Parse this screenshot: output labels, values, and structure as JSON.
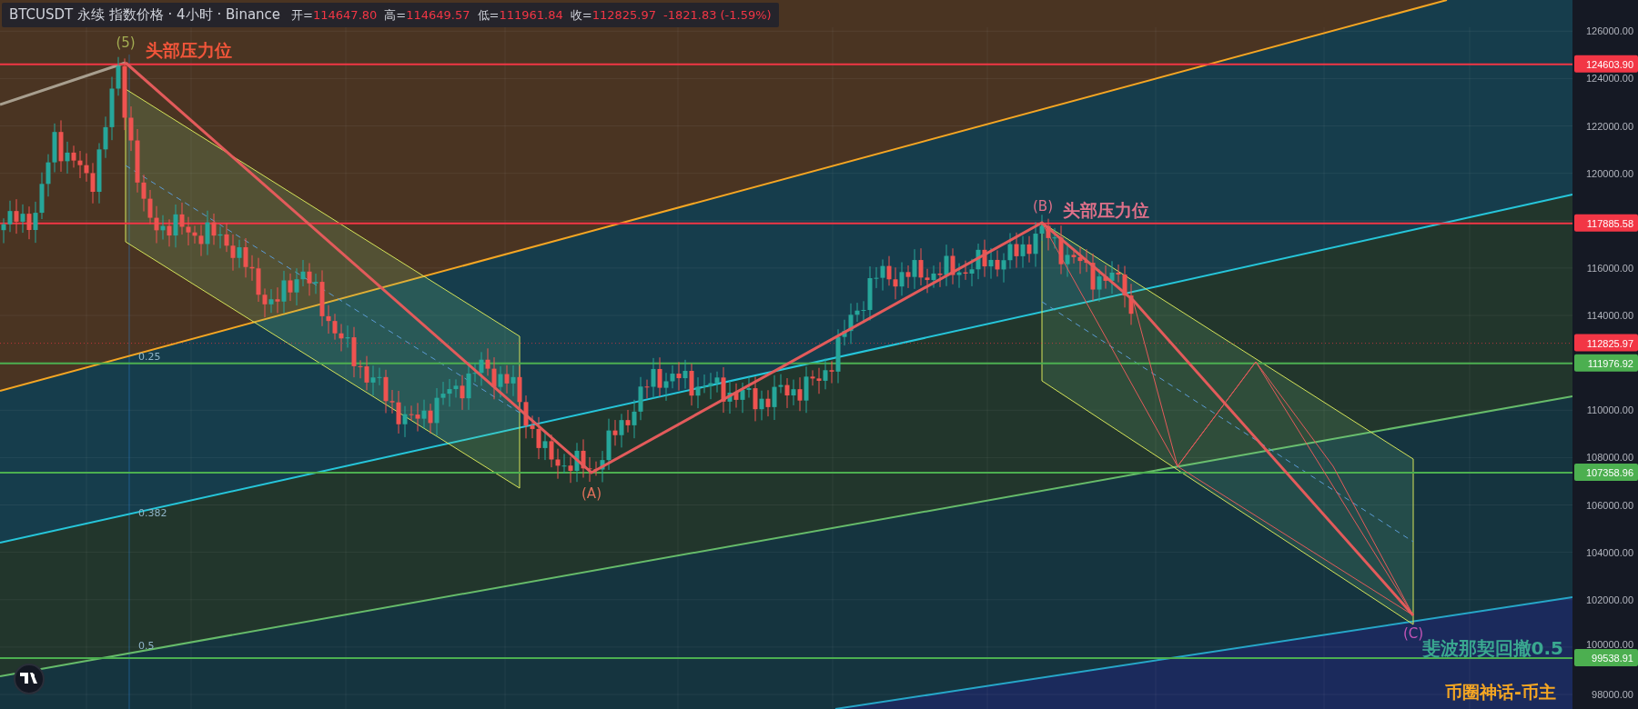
{
  "header": {
    "symbol": "BTCUSDT 永续 指数价格 · 4小时 · Binance",
    "ohlc": [
      {
        "label": "开=",
        "value": "114647.80"
      },
      {
        "label": "高=",
        "value": "114649.57"
      },
      {
        "label": "低=",
        "value": "111961.84"
      },
      {
        "label": "收=",
        "value": "112825.97"
      }
    ],
    "change": "-1821.83 (-1.59%)"
  },
  "wave_labels": [
    "(5)",
    "(A)",
    "(B)",
    "(C)"
  ],
  "resistance_labels": [
    "头部压力位",
    "头部压力位"
  ],
  "fib_levels": [
    "0.25",
    "0.382",
    "0.5"
  ],
  "fib_note": "斐波那契回撤0.5",
  "signature": "币圈神话-币主",
  "price_axis": {
    "ticks": [
      "126000.00",
      "124000.00",
      "122000.00",
      "120000.00",
      "116000.00",
      "114000.00",
      "110000.00",
      "108000.00",
      "106000.00",
      "104000.00",
      "102000.00",
      "100000.00",
      "98000.00"
    ],
    "price_labels": [
      {
        "kind": "level",
        "value": "124603.90",
        "color": "#f23645"
      },
      {
        "kind": "level",
        "value": "117885.58",
        "color": "#f23645"
      },
      {
        "kind": "last_price",
        "value": "112825.97",
        "color": "#f23645"
      },
      {
        "kind": "level",
        "value": "111976.92",
        "color": "#4caf50"
      },
      {
        "kind": "level",
        "value": "107358.96",
        "color": "#4caf50"
      },
      {
        "kind": "level",
        "value": "99538.91",
        "color": "#4caf50"
      }
    ]
  }
}
